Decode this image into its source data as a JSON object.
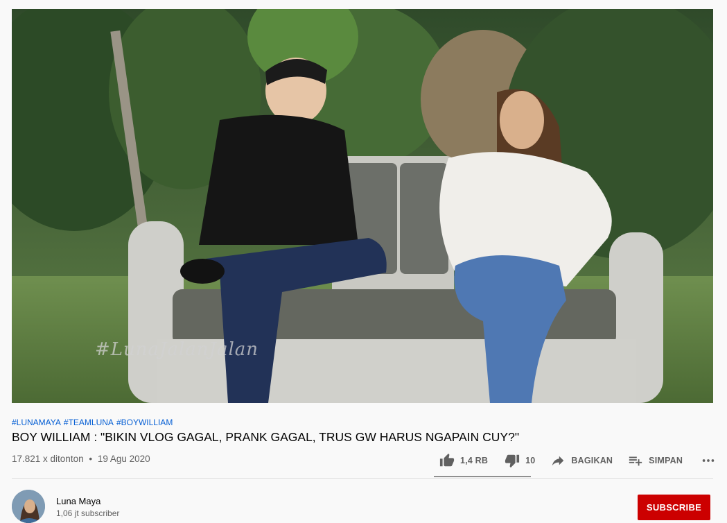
{
  "video": {
    "watermark": "#LunaJalanJalan"
  },
  "hashtags": [
    "#LUNAMAYA",
    "#TEAMLUNA",
    "#BOYWILLIAM"
  ],
  "title": "BOY WILLIAM : \"BIKIN VLOG GAGAL, PRANK GAGAL, TRUS GW HARUS NGAPAIN CUY?\"",
  "meta": {
    "views": "17.821 x ditonton",
    "separator": "•",
    "date": "19 Agu 2020"
  },
  "actions": {
    "like_count": "1,4 RB",
    "dislike_count": "10",
    "share_label": "BAGIKAN",
    "save_label": "SIMPAN"
  },
  "channel": {
    "name": "Luna Maya",
    "subscribers": "1,06 jt subscriber",
    "subscribe_label": "SUBSCRIBE"
  },
  "colors": {
    "subscribe_bg": "#cc0000",
    "hashtag": "#065fd4"
  },
  "icons": {
    "like": "thumb-up-icon",
    "dislike": "thumb-down-icon",
    "share": "share-arrow-icon",
    "save": "playlist-add-icon",
    "more": "more-horizontal-icon"
  }
}
